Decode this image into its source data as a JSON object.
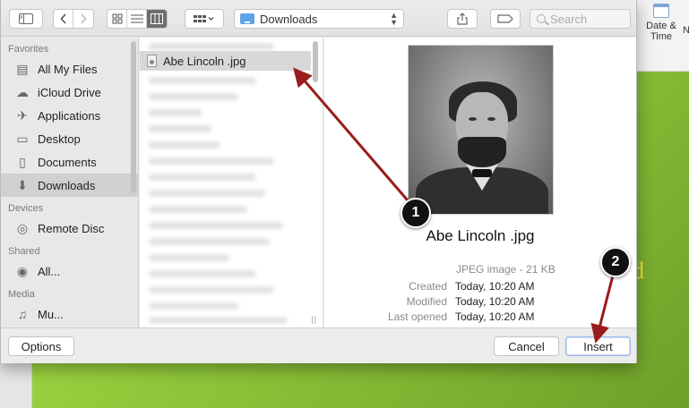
{
  "background_app": {
    "date_time_label_1": "Date &",
    "date_time_label_2": "Time",
    "partial_label": "N",
    "partial_slide_text": "d"
  },
  "toolbar": {
    "location": "Downloads",
    "search_placeholder": "Search"
  },
  "sidebar": {
    "sections": [
      {
        "header": "Favorites",
        "items": [
          {
            "label": "All My Files",
            "icon": "all-files-icon"
          },
          {
            "label": "iCloud Drive",
            "icon": "cloud-icon"
          },
          {
            "label": "Applications",
            "icon": "applications-icon"
          },
          {
            "label": "Desktop",
            "icon": "desktop-icon"
          },
          {
            "label": "Documents",
            "icon": "documents-icon"
          },
          {
            "label": "Downloads",
            "icon": "downloads-icon",
            "selected": true
          }
        ]
      },
      {
        "header": "Devices",
        "items": [
          {
            "label": "Remote Disc",
            "icon": "disc-icon"
          }
        ]
      },
      {
        "header": "Shared",
        "items": [
          {
            "label": "All...",
            "icon": "network-icon"
          }
        ]
      },
      {
        "header": "Media",
        "items": [
          {
            "label": "Mu...",
            "icon": "music-icon"
          }
        ]
      }
    ]
  },
  "files": {
    "selected_name": "Abe Lincoln .jpg"
  },
  "preview": {
    "name": "Abe Lincoln .jpg",
    "kind": "JPEG image - 21 KB",
    "rows": [
      {
        "key": "Created",
        "value": "Today, 10:20 AM"
      },
      {
        "key": "Modified",
        "value": "Today, 10:20 AM"
      },
      {
        "key": "Last opened",
        "value": "Today, 10:20 AM"
      }
    ]
  },
  "footer": {
    "options_label": "Options",
    "cancel_label": "Cancel",
    "insert_label": "Insert"
  },
  "annotations": {
    "badge_1": "1",
    "badge_2": "2",
    "arrow_color": "#9b1c1c"
  }
}
